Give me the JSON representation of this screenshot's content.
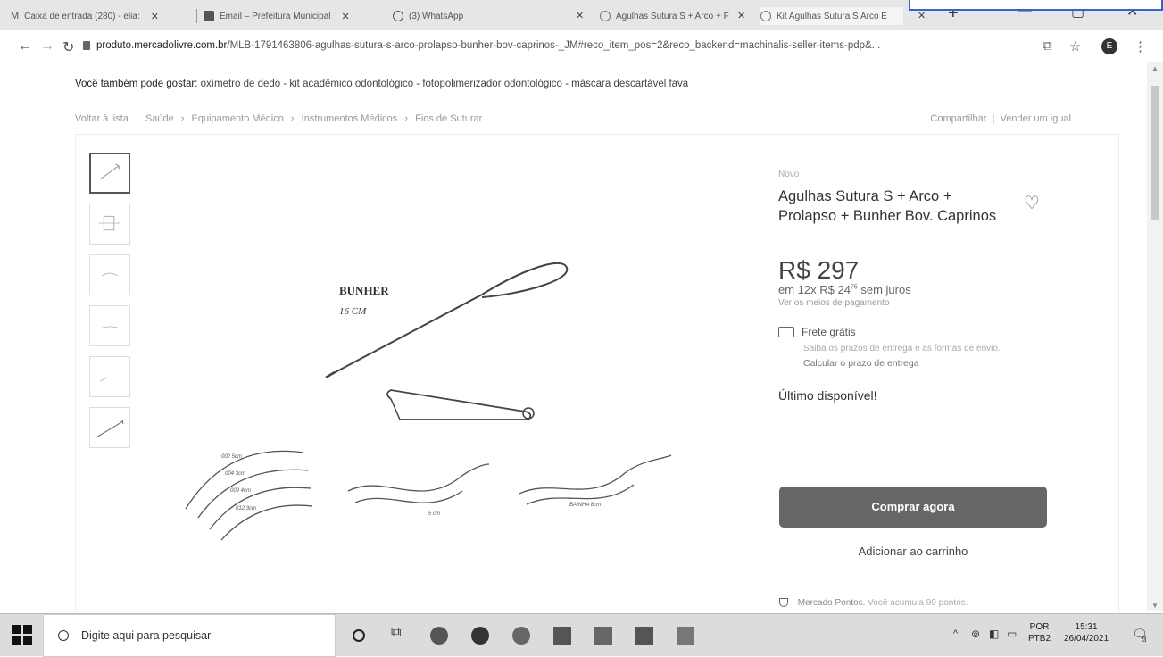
{
  "browser": {
    "tabs": [
      {
        "label": "Caixa de entrada (280) - elia:",
        "icon": "gmail-icon"
      },
      {
        "label": "Email – Prefeitura Municipal",
        "icon": "outlook-icon"
      },
      {
        "label": "(3) WhatsApp",
        "icon": "whatsapp-icon"
      },
      {
        "label": "Agulhas Sutura S + Arco + F",
        "icon": "mercadolivre-icon"
      },
      {
        "label": "Kit Agulhas Sutura S Arco E",
        "icon": "mercadolivre-icon"
      }
    ],
    "url_host": "produto.mercadolivre.com.br",
    "url_path": "/MLB-1791463806-agulhas-sutura-s-arco-prolapso-bunher-bov-caprinos-_JM#reco_item_pos=2&reco_backend=machinalis-seller-items-pdp&...",
    "profile_initial": "E"
  },
  "page": {
    "suggest_label": "Você também pode gostar:",
    "suggest_items": "oxímetro de dedo - kit acadêmico odontológico - fotopolimerizador odontológico - máscara descartável fava",
    "back_label": "Voltar à lista",
    "breadcrumb": [
      "Saúde",
      "Equipamento Médico",
      "Instrumentos Médicos",
      "Fios de Suturar"
    ],
    "share_label": "Compartilhar",
    "sell_label": "Vender um igual"
  },
  "image": {
    "label_title": "BUNHER",
    "label_size": "16 CM",
    "arc_labels": [
      "002 5cm",
      "004 3cm",
      "009 4cm",
      "012 3cm"
    ],
    "s_label_1": "5 cm",
    "s_label_2": "BAINHA 8cm"
  },
  "product": {
    "condition": "Novo",
    "title": "Agulhas Sutura S + Arco + Prolapso + Bunher Bov. Caprinos",
    "price": "R$ 297",
    "installments_prefix": "em 12x R$ 24",
    "installments_cents": "75",
    "installments_suffix": "sem juros",
    "payment_link": "Ver os meios de pagamento",
    "shipping": "Frete grátis",
    "shipping_sub": "Saiba os prazos de entrega e as formas de envio.",
    "shipping_calc": "Calcular o prazo de entrega",
    "stock": "Último disponível!",
    "buy_label": "Comprar agora",
    "cart_label": "Adicionar ao carrinho",
    "points_label": "Mercado Pontos.",
    "points_text": "Você acumula 99 pontos."
  },
  "taskbar": {
    "search_placeholder": "Digite aqui para pesquisar",
    "lang": "POR",
    "layout": "PTB2",
    "time": "15:31",
    "date": "26/04/2021",
    "notifications": "3"
  }
}
